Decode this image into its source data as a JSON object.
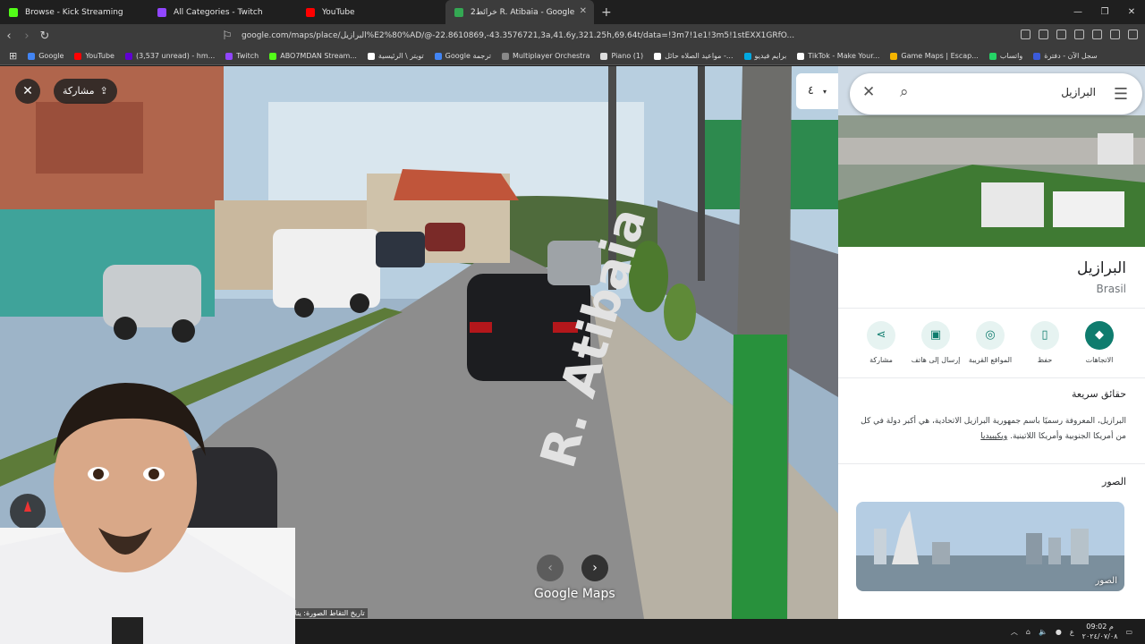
{
  "browser": {
    "tabs": [
      {
        "title": "Browse - Kick Streaming",
        "color": "#53fc18"
      },
      {
        "title": "All Categories - Twitch",
        "color": "#9146ff"
      },
      {
        "title": "YouTube",
        "color": "#ff0000"
      },
      {
        "title": "خرائط2 R. Atibaia - Google",
        "color": "#34a853",
        "active": true
      }
    ],
    "url": "google.com/maps/place/البرازيل%E2%80%AD/@-22.8610869,-43.3576721,3a,41.6y,321.25h,69.64t/data=!3m7!1e1!3m5!1stEXX1GRfO...",
    "bookmarks": [
      {
        "label": "Google",
        "color": "#4285f4"
      },
      {
        "label": "YouTube",
        "color": "#ff0000"
      },
      {
        "label": "(3,537 unread) - hm...",
        "color": "#6001d2"
      },
      {
        "label": "Twitch",
        "color": "#9146ff"
      },
      {
        "label": "ABO7MDAN Stream...",
        "color": "#53fc18"
      },
      {
        "label": "تويتر \\ الرئيسية",
        "color": "#ffffff"
      },
      {
        "label": "Google ترجمة",
        "color": "#4285f4"
      },
      {
        "label": "Multiplayer Orchestra",
        "color": "#888888"
      },
      {
        "label": "Piano (1)",
        "color": "#dddddd"
      },
      {
        "label": "مواعيد الصلاه حائل -...",
        "color": "#ffffff"
      },
      {
        "label": "برايم فيديو",
        "color": "#00a8e1"
      },
      {
        "label": "TikTok - Make Your...",
        "color": "#ffffff"
      },
      {
        "label": "Game Maps | Escap...",
        "color": "#f4b400"
      },
      {
        "label": "واتساب",
        "color": "#25d366"
      },
      {
        "label": "سجل الآن - دفترة",
        "color": "#3b5bdb"
      }
    ]
  },
  "streetview": {
    "share_label": "مشاركة",
    "minimap_label": "٤",
    "street_text": "R. Atibaia",
    "logo": "Google Maps",
    "capture_date": "تاريخ التقاط الصورة: يناير"
  },
  "panel": {
    "search_query": "البرازيل",
    "title": "البرازيل",
    "subtitle": "Brasil",
    "actions": [
      {
        "label": "الاتجاهات",
        "icon": "directions-icon",
        "primary": true
      },
      {
        "label": "حفظ",
        "icon": "bookmark-icon"
      },
      {
        "label": "المواقع القريبة",
        "icon": "nearby-icon"
      },
      {
        "label": "إرسال إلى هاتف",
        "icon": "send-to-phone-icon"
      },
      {
        "label": "مشاركة",
        "icon": "share-icon"
      }
    ],
    "quick_facts_title": "حقائق سريعة",
    "quick_facts_body": "البرازيل، المعروفة رسميًا باسم جمهورية البرازيل الاتحادية، هي أكبر دولة في كل من أمريكا الجنوبية وأمريكا اللاتينية.",
    "quick_facts_link": "ويكيبيديا",
    "photos_title": "الصور",
    "photo_label": "الصور"
  },
  "taskbar": {
    "time": "09:02 م",
    "date": "٢٠٢٤/٠٧/٠٨",
    "lang": "ع"
  }
}
